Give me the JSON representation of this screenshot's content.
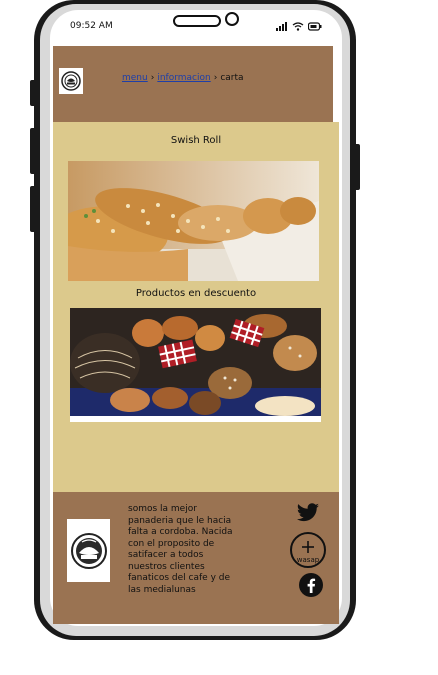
{
  "status_bar": {
    "time": "09:52 AM"
  },
  "header": {
    "breadcrumb": [
      {
        "label": "menu",
        "link": true
      },
      {
        "label": "informacion",
        "link": true
      },
      {
        "label": "carta",
        "link": false
      }
    ],
    "separator": "›"
  },
  "main": {
    "featured_title": "Swish Roll",
    "discount_title": "Productos en descuento"
  },
  "footer": {
    "description": "somos la mejor panaderia que le hacia falta a cordoba. Nacida con el proposito de satifacer a todos nuestros clientes fanaticos del cafe y de las medialunas",
    "social_label": "wasap",
    "icons": [
      "twitter-icon",
      "whatsapp-icon",
      "facebook-icon"
    ]
  },
  "colors": {
    "brown": "#9a7352",
    "content_bg": "#dcc98c",
    "link": "#1f3fa8"
  }
}
